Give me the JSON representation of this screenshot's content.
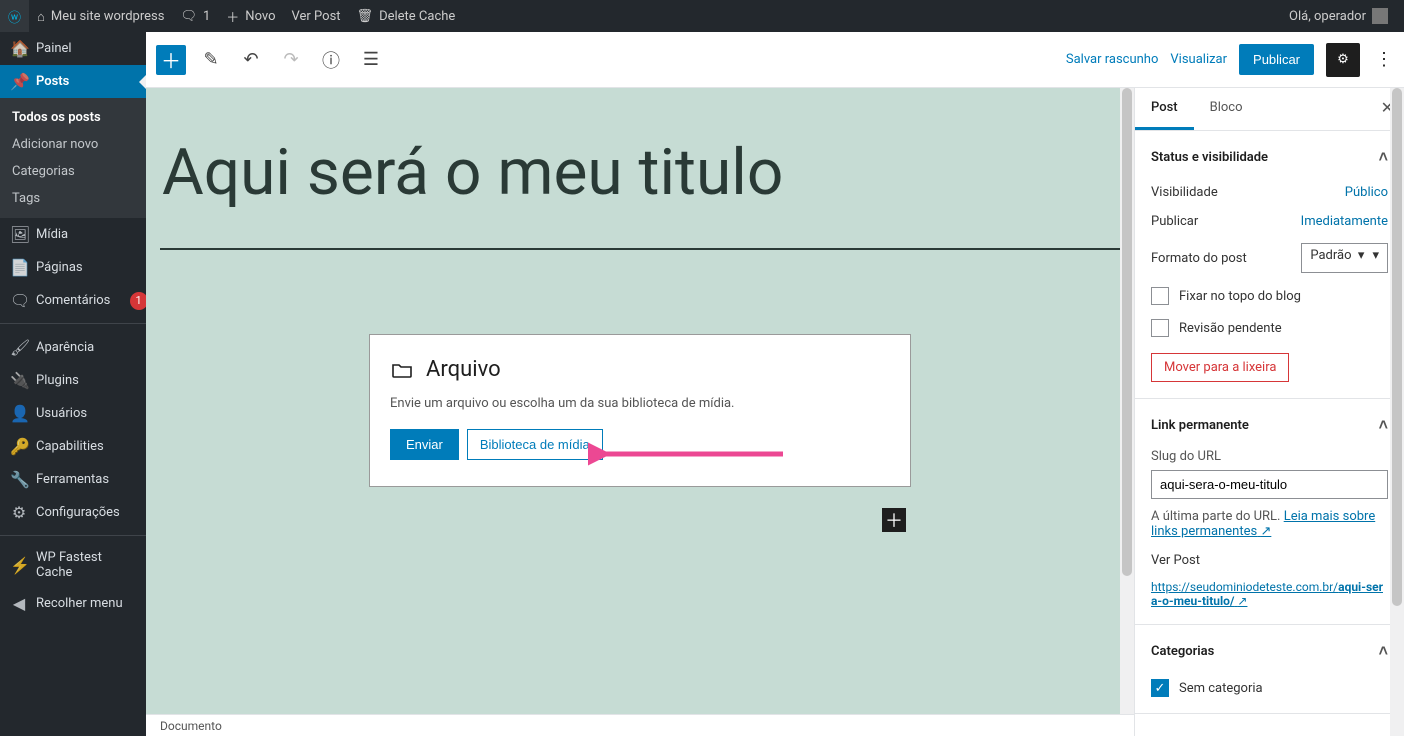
{
  "adminbar": {
    "site": "Meu site wordpress",
    "comments": "1",
    "new": "Novo",
    "viewpost": "Ver Post",
    "deletecache": "Delete Cache",
    "greeting": "Olá, operador"
  },
  "sidebar": {
    "dashboard": "Painel",
    "posts": "Posts",
    "posts_sub": {
      "all": "Todos os posts",
      "add": "Adicionar novo",
      "cats": "Categorias",
      "tags": "Tags"
    },
    "media": "Mídia",
    "pages": "Páginas",
    "comments": "Comentários",
    "comments_badge": "1",
    "appearance": "Aparência",
    "plugins": "Plugins",
    "users": "Usuários",
    "capabilities": "Capabilities",
    "tools": "Ferramentas",
    "settings": "Configurações",
    "wpfc": "WP Fastest Cache",
    "collapse": "Recolher menu"
  },
  "editorbar": {
    "savedraft": "Salvar rascunho",
    "preview": "Visualizar",
    "publish": "Publicar"
  },
  "post": {
    "title": "Aqui será o meu titulo"
  },
  "fileblock": {
    "heading": "Arquivo",
    "desc": "Envie um arquivo ou escolha um da sua biblioteca de mídia.",
    "upload": "Enviar",
    "library": "Biblioteca de mídia"
  },
  "rsb": {
    "tab_post": "Post",
    "tab_block": "Bloco",
    "status_h": "Status e visibilidade",
    "visibility_l": "Visibilidade",
    "visibility_v": "Público",
    "publish_l": "Publicar",
    "publish_v": "Imediatamente",
    "format_l": "Formato do post",
    "format_v": "Padrão",
    "stick": "Fixar no topo do blog",
    "pending": "Revisão pendente",
    "trash": "Mover para a lixeira",
    "permalink_h": "Link permanente",
    "slug_l": "Slug do URL",
    "slug_v": "aqui-sera-o-meu-titulo",
    "permalink_desc": "A última parte do URL. ",
    "permalink_more": "Leia mais sobre links permanentes",
    "viewpost_l": "Ver Post",
    "permalink_url_a": "https://seudominiodeteste.com.br/",
    "permalink_url_b": "aqui-sera-o-meu-titulo/",
    "cats_h": "Categorias",
    "cat_uncat": "Sem categoria"
  },
  "breadcrumb": "Documento"
}
